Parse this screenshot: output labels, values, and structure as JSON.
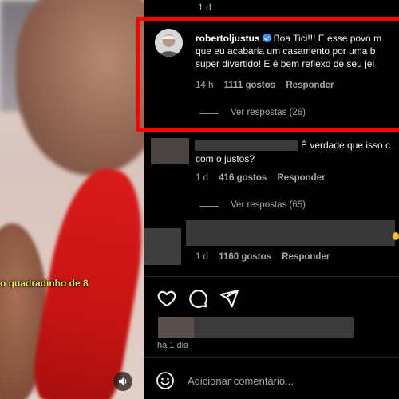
{
  "video": {
    "caption": "o quadradinho de 8"
  },
  "comments": [
    {
      "time": "1 d"
    },
    {
      "username": "robertoljustus",
      "text_line1": "Boa Tici!!! E esse povo m",
      "text_line2": "que eu acabaria um casamento por uma b",
      "text_line3": "super divertido! E é bem reflexo de seu jei",
      "time": "14 h",
      "likes": "1111 gostos",
      "reply": "Responder",
      "view_replies": "Ver respostas (26)"
    },
    {
      "text_line1": "É verdade que isso c",
      "text_line2": "com o justos?",
      "time": "1 d",
      "likes": "416 gostos",
      "reply": "Responder",
      "view_replies": "Ver respostas (65)"
    },
    {
      "time": "1 d",
      "likes": "1160 gostos",
      "reply": "Responder"
    }
  ],
  "post": {
    "posted_time": "há 1 dia",
    "add_comment_placeholder": "Adicionar comentário..."
  },
  "colors": {
    "highlight": "#ff0000",
    "verified": "#3897f0",
    "caption": "#f2e64a"
  }
}
